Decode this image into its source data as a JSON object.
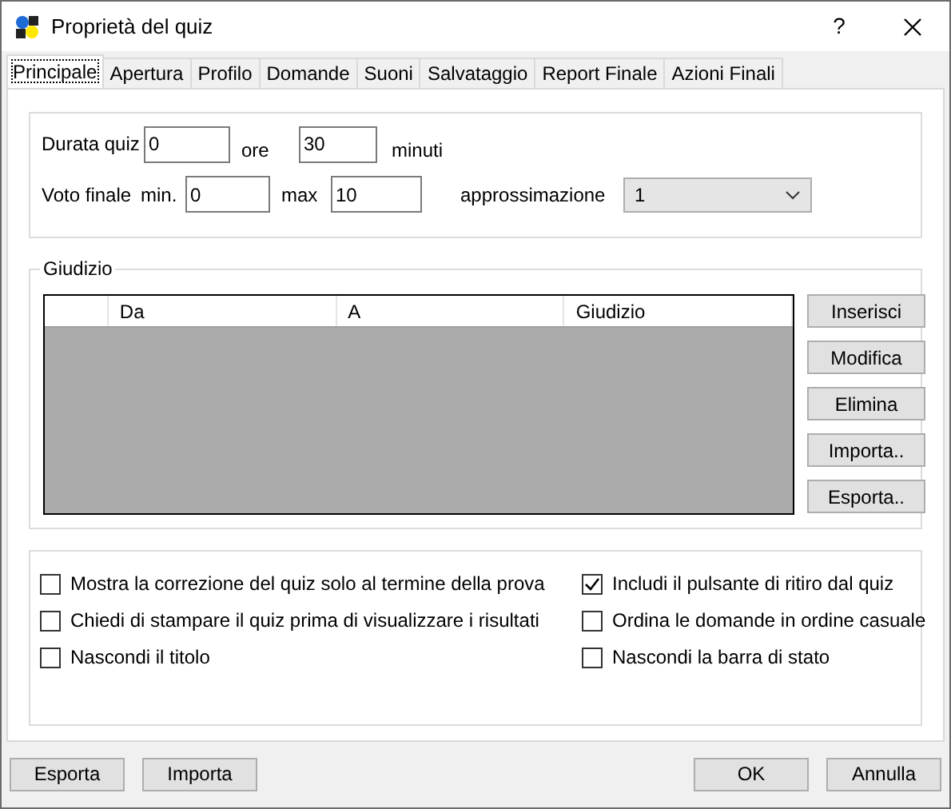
{
  "window": {
    "title": "Proprietà del quiz",
    "help": "?"
  },
  "tabs": [
    {
      "label": "Principale",
      "selected": true
    },
    {
      "label": "Apertura",
      "selected": false
    },
    {
      "label": "Profilo",
      "selected": false
    },
    {
      "label": "Domande",
      "selected": false
    },
    {
      "label": "Suoni",
      "selected": false
    },
    {
      "label": "Salvataggio",
      "selected": false
    },
    {
      "label": "Report Finale",
      "selected": false
    },
    {
      "label": "Azioni Finali",
      "selected": false
    }
  ],
  "duration": {
    "label": "Durata quiz",
    "hours": "0",
    "hours_unit": "ore",
    "minutes": "30",
    "minutes_unit": "minuti"
  },
  "final_grade": {
    "label": "Voto finale",
    "min_label": "min.",
    "min": "0",
    "max_label": "max",
    "max": "10",
    "rounding_label": "approssimazione",
    "rounding": "1"
  },
  "grading": {
    "title": "Giudizio",
    "columns": [
      "Da",
      "A",
      "Giudizio"
    ],
    "buttons": [
      "Inserisci",
      "Modifica",
      "Elimina",
      "Importa..",
      "Esporta.."
    ]
  },
  "options": [
    {
      "label": "Mostra la correzione del quiz solo al termine della prova",
      "checked": false
    },
    {
      "label": "Includi il pulsante di ritiro dal quiz",
      "checked": true
    },
    {
      "label": "Chiedi di stampare il quiz prima di visualizzare i risultati",
      "checked": false
    },
    {
      "label": "Ordina le domande in ordine casuale",
      "checked": false
    },
    {
      "label": "Nascondi il titolo",
      "checked": false
    },
    {
      "label": "Nascondi la barra di stato",
      "checked": false
    }
  ],
  "footer_left": [
    "Esporta",
    "Importa"
  ],
  "footer_right": [
    "OK",
    "Annulla"
  ]
}
